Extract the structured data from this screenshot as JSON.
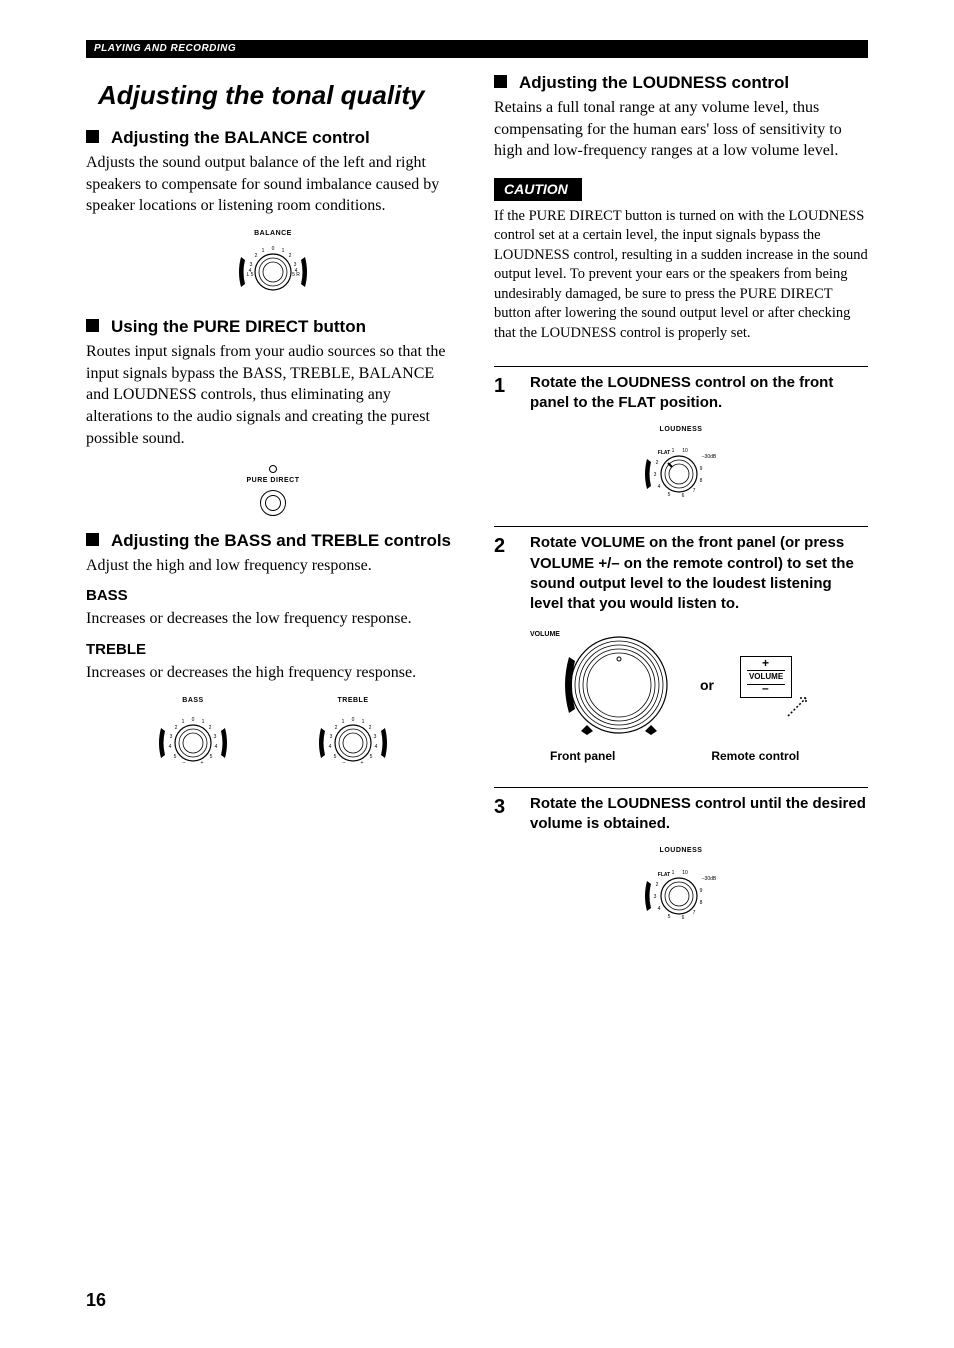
{
  "sectionHeader": "PLAYING AND RECORDING",
  "pageNumber": "16",
  "left": {
    "title": "Adjusting the tonal quality",
    "balance": {
      "heading": "Adjusting the BALANCE control",
      "body": "Adjusts the sound output balance of the left and right speakers to compensate for sound imbalance caused by speaker locations or listening room conditions.",
      "knobLabel": "BALANCE"
    },
    "pureDirect": {
      "heading": "Using the PURE DIRECT button",
      "body": "Routes input signals from your audio sources so that the input signals bypass the BASS, TREBLE, BALANCE and LOUDNESS controls, thus eliminating any alterations to the audio signals and creating the purest possible sound.",
      "btnLabel": "PURE DIRECT"
    },
    "bassTreble": {
      "heading": "Adjusting the BASS and TREBLE controls",
      "body": "Adjust the high and low frequency response.",
      "bassLabel": "BASS",
      "bassBody": "Increases or decreases the low frequency response.",
      "trebleLabel": "TREBLE",
      "trebleBody": "Increases or decreases the high frequency response.",
      "knobBass": "BASS",
      "knobTreble": "TREBLE"
    }
  },
  "right": {
    "loudness": {
      "heading": "Adjusting the LOUDNESS control",
      "body": "Retains a full tonal range at any volume level, thus compensating for the human ears' loss of sensitivity to high and low-frequency ranges at a low volume level.",
      "cautionLabel": "CAUTION",
      "cautionBody": "If the PURE DIRECT button is turned on with the LOUDNESS control set at a certain level, the input signals bypass the LOUDNESS control, resulting in a sudden increase in the sound output level. To prevent your ears or the speakers from being undesirably damaged, be sure to press the PURE DIRECT button after lowering the sound output level or after checking that the LOUDNESS control is properly set."
    },
    "steps": {
      "s1": {
        "num": "1",
        "text": "Rotate the LOUDNESS control on the front panel to the FLAT position.",
        "knobLabel": "LOUDNESS",
        "flat": "FLAT",
        "db": "–30dB"
      },
      "s2": {
        "num": "2",
        "text": "Rotate VOLUME on the front panel (or press VOLUME +/– on the remote control) to set the sound output level to the loudest listening level that you would listen to.",
        "volumeLabel": "VOLUME",
        "or": "or",
        "remoteVol": "VOLUME",
        "capFront": "Front panel",
        "capRemote": "Remote control"
      },
      "s3": {
        "num": "3",
        "text": "Rotate the LOUDNESS control until the desired volume is obtained.",
        "knobLabel": "LOUDNESS",
        "flat": "FLAT",
        "db": "–30dB"
      }
    }
  }
}
